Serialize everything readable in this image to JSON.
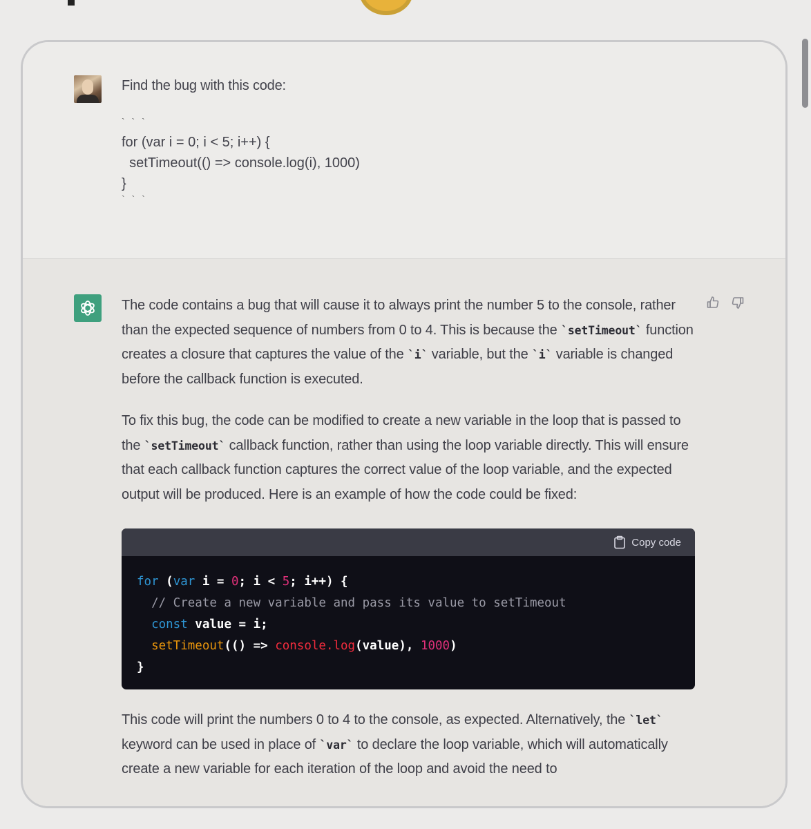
{
  "user_message": {
    "text": "Find the bug with this code:",
    "code_fence_open": "` ` `",
    "code_lines": [
      "for (var i = 0; i < 5; i++) {",
      "  setTimeout(() => console.log(i), 1000)",
      "}"
    ],
    "code_fence_close": "` ` `"
  },
  "assistant_message": {
    "p1": {
      "t1": "The code contains a bug that will cause it to always print the number 5 to the console, rather than the expected sequence of numbers from 0 to 4. This is because the ",
      "c1": "`setTimeout`",
      "t2": " function creates a closure that captures the value of the ",
      "c2": "`i`",
      "t3": " variable, but the ",
      "c3": "`i`",
      "t4": " variable is changed before the callback function is executed."
    },
    "p2": {
      "t1": "To fix this bug, the code can be modified to create a new variable in the loop that is passed to the ",
      "c1": "`setTimeout`",
      "t2": " callback function, rather than using the loop variable directly. This will ensure that each callback function captures the correct value of the loop variable, and the expected output will be produced. Here is an example of how the code could be fixed:"
    },
    "code_block": {
      "copy_label": "Copy code",
      "line1": {
        "kw": "for",
        "a": " (",
        "kw2": "var",
        "b": " i = ",
        "n1": "0",
        "c": "; i < ",
        "n2": "5",
        "d": "; i++) {"
      },
      "line2": {
        "comment": "  // Create a new variable and pass its value to setTimeout"
      },
      "line3": {
        "indent": "  ",
        "kw": "const",
        "rest": " value = i;"
      },
      "line4": {
        "indent": "  ",
        "fn": "setTimeout",
        "a": "(() => ",
        "fn2": "console.log",
        "b": "(value), ",
        "num": "1000",
        "c": ")"
      },
      "line5": "}"
    },
    "p3": {
      "t1": "This code will print the numbers 0 to 4 to the console, as expected. Alternatively, the ",
      "c1": "`let`",
      "t2": " keyword can be used in place of ",
      "c2": "`var`",
      "t3": " to declare the loop variable, which will automatically create a new variable for each iteration of the loop and avoid the need to"
    },
    "actions": {
      "thumbs_up_icon": "thumbs-up-icon",
      "thumbs_down_icon": "thumbs-down-icon"
    }
  },
  "colors": {
    "assistant_avatar": "#3fa07e",
    "code_bg": "#0f0f17",
    "code_header": "#3a3b45",
    "keyword": "#2e95d3",
    "number": "#df3079",
    "function": "#f22c3d",
    "method": "#e9950c"
  }
}
